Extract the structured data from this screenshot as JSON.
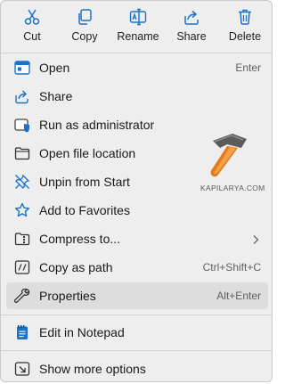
{
  "toolbar": {
    "cut": "Cut",
    "copy": "Copy",
    "rename": "Rename",
    "share": "Share",
    "delete": "Delete"
  },
  "menu": {
    "open": {
      "label": "Open",
      "shortcut": "Enter"
    },
    "share": {
      "label": "Share"
    },
    "run_admin": {
      "label": "Run as administrator"
    },
    "open_location": {
      "label": "Open file location"
    },
    "unpin": {
      "label": "Unpin from Start"
    },
    "favorites": {
      "label": "Add to Favorites"
    },
    "compress": {
      "label": "Compress to..."
    },
    "copy_path": {
      "label": "Copy as path",
      "shortcut": "Ctrl+Shift+C"
    },
    "properties": {
      "label": "Properties",
      "shortcut": "Alt+Enter"
    },
    "notepad": {
      "label": "Edit in Notepad"
    },
    "more_options": {
      "label": "Show more options"
    }
  },
  "watermark": "KAPILARYA.COM",
  "colors": {
    "accent": "#1a73c9",
    "menu_bg": "#eeeeee",
    "highlight": "#dddddd"
  }
}
